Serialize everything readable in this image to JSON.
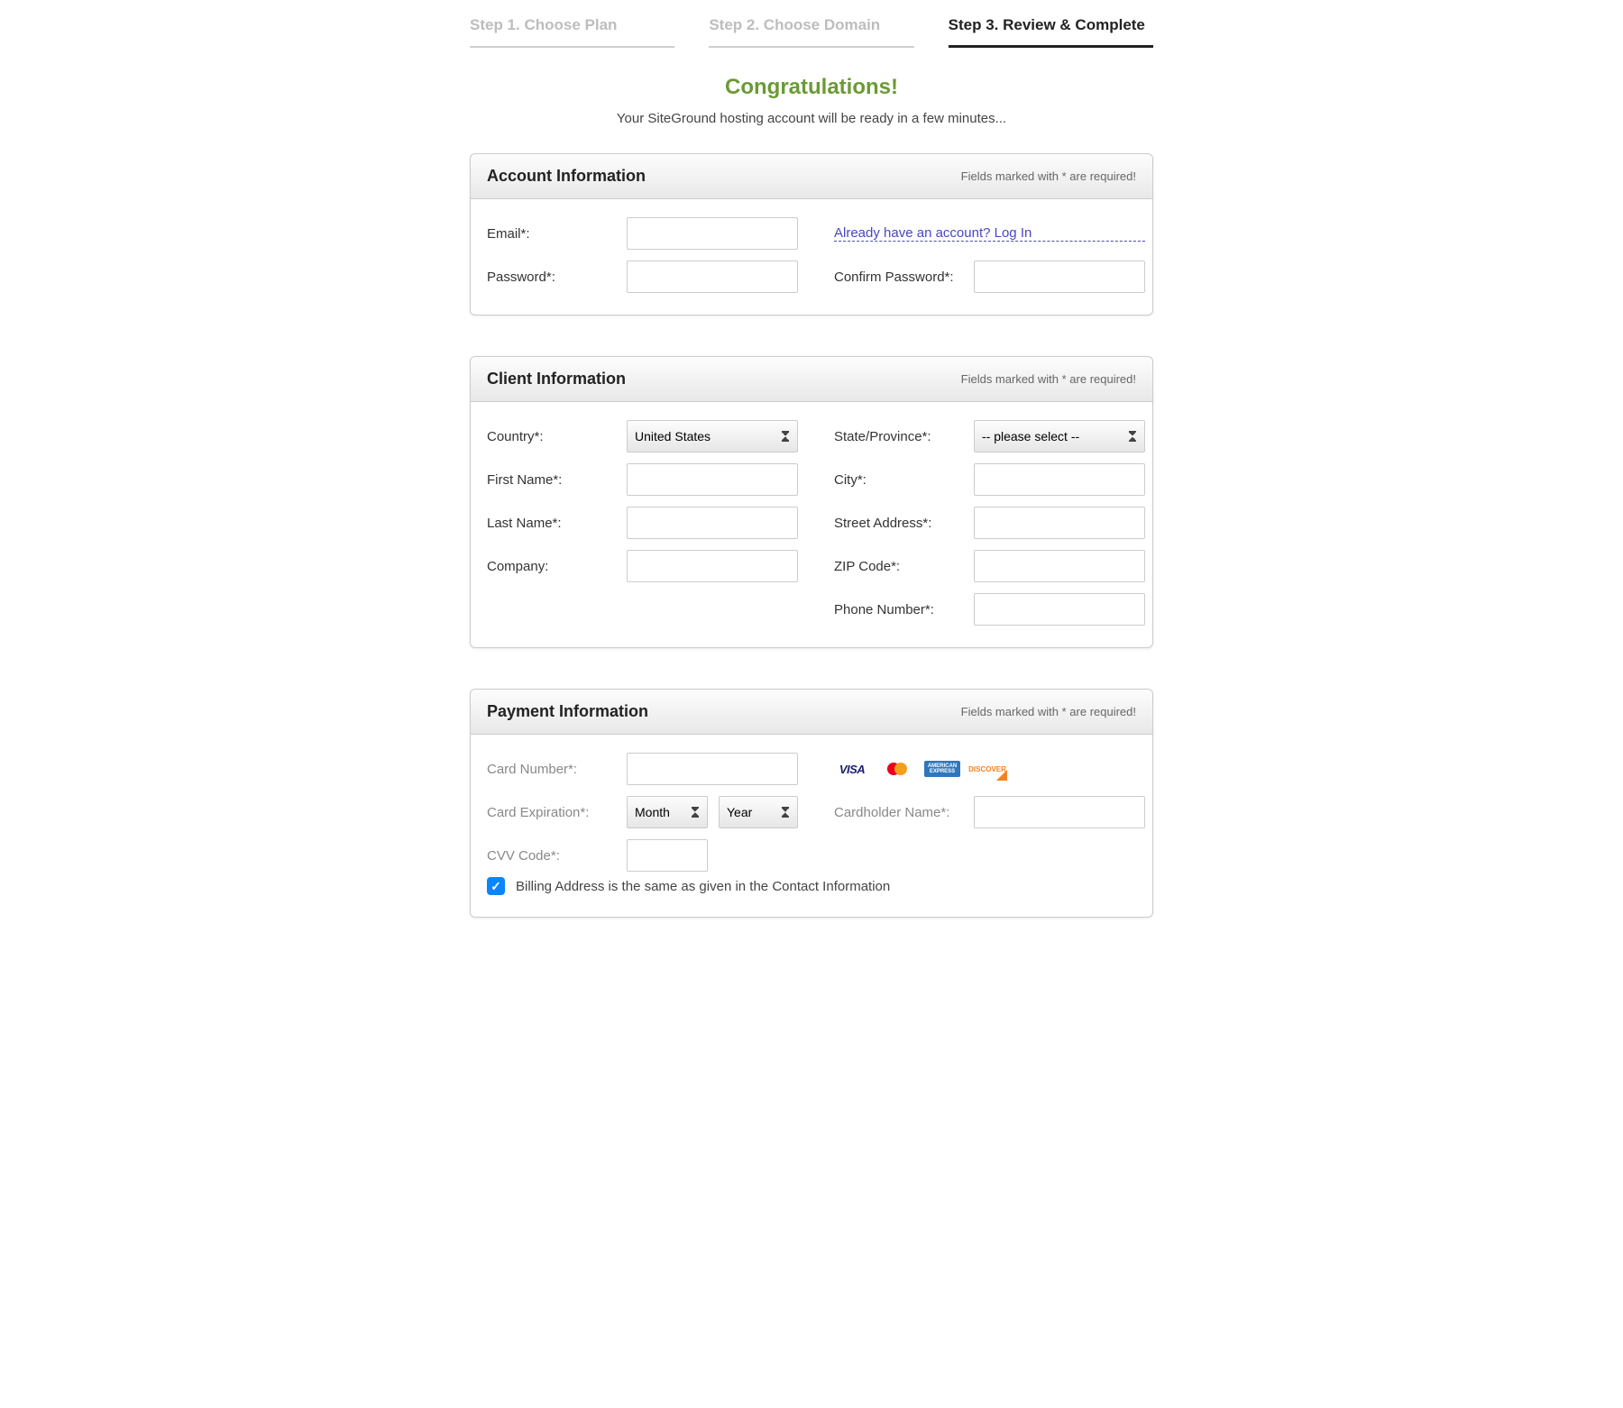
{
  "steps": {
    "s1": "Step 1. Choose Plan",
    "s2": "Step 2. Choose Domain",
    "s3": "Step 3. Review & Complete"
  },
  "congrats": "Congratulations!",
  "subtext": "Your SiteGround hosting account will be ready in a few minutes...",
  "required_note": "Fields marked with * are required!",
  "account": {
    "title": "Account Information",
    "email": "Email*:",
    "password": "Password*:",
    "confirm": "Confirm Password*:",
    "login_link": "Already have an account? Log In"
  },
  "client": {
    "title": "Client Information",
    "country": "Country*:",
    "country_value": "United States",
    "first_name": "First Name*:",
    "last_name": "Last Name*:",
    "company": "Company:",
    "state": "State/Province*:",
    "state_value": "-- please select --",
    "city": "City*:",
    "street": "Street Address*:",
    "zip": "ZIP Code*:",
    "phone": "Phone Number*:"
  },
  "payment": {
    "title": "Payment Information",
    "card_number": "Card Number*:",
    "card_exp": "Card Expiration*:",
    "month": "Month",
    "year": "Year",
    "cvv": "CVV Code*:",
    "cardholder": "Cardholder Name*:",
    "billing_same": "Billing Address is the same as given in the Contact Information",
    "cards": {
      "visa": "VISA",
      "amex": "AMERICAN EXPRESS",
      "discover": "DISCOVER"
    }
  }
}
